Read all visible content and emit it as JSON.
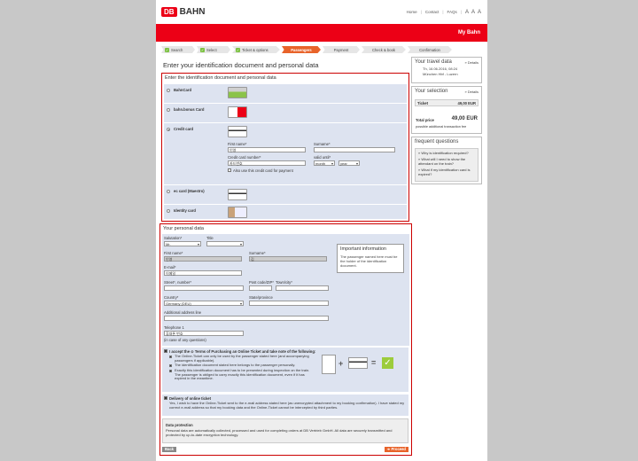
{
  "header": {
    "logo_db": "DB",
    "logo_bahn": "BAHN",
    "links": [
      "Home",
      "Contact",
      "FAQs"
    ],
    "text_size": "A A A",
    "section": "My Bahn"
  },
  "steps": [
    {
      "label": "Search",
      "done": true
    },
    {
      "label": "Select",
      "done": true
    },
    {
      "label": "Ticket & options",
      "done": true
    },
    {
      "label": "Passengers",
      "active": true
    },
    {
      "label": "Payment"
    },
    {
      "label": "Check & book"
    },
    {
      "label": "Confirmation"
    }
  ],
  "page_title": "Enter your identification document and personal data",
  "id_panel": {
    "title": "Enter the identification document and personal data",
    "options": [
      {
        "label": "BahnCard",
        "selected": false
      },
      {
        "label": "bahn.bonus Card",
        "selected": false
      },
      {
        "label": "Credit card",
        "selected": true
      },
      {
        "label": "ec card (Maestro)",
        "selected": false
      },
      {
        "label": "Identity card",
        "selected": false
      }
    ],
    "credit": {
      "first_name_label": "First name*",
      "first_name_value": "인영",
      "surname_label": "Surname*",
      "surname_value": "",
      "number_label": "Credit card number*",
      "number_value": "카드번호",
      "valid_label": "valid until*",
      "month": "month",
      "year": "year",
      "also_label": "Also use this credit card for payment"
    }
  },
  "personal": {
    "title": "Your personal data",
    "salutation_label": "Salutation*",
    "salutation_value": "Mr.",
    "title_label": "Title",
    "title_value": "",
    "first_label": "First name*",
    "first_value": "인영",
    "surname_label": "Surname*",
    "surname_value": "김",
    "email_label": "E-mail*",
    "email_value": "이메일",
    "street_label": "Street*, number*",
    "postcode_label": "Post code/ZIP*",
    "town_label": "Town/city*",
    "country_label": "Country*",
    "country_value": "Germany (DEU)",
    "state_label": "State/province",
    "addl_label": "Additional address line",
    "phone_label": "Telephone 1",
    "phone_value": "휴대폰 번호",
    "phone_hint": "(in case of any questions)",
    "info_title": "Important information",
    "info_body": "The passenger named here must be the holder of the identification document.",
    "terms_intro": "I accept the ⊙ Terms of Purchasing an Online Ticket and take note of the following:",
    "terms": [
      "The Online-Ticket can only be used by the passenger stated here (and accompanying passengers if applicable).",
      "The identification document stated here belongs to the passenger personally.",
      "Exactly this identification document has to be presented during inspection on the train. The passenger is obliged to carry exactly this identification document, even if it has expired in the meantime."
    ],
    "delivery_title": "Delivery of online ticket",
    "delivery_body": "Yes, I wish to have the Online-Ticket sent to the e-mail address stated here (as unencrypted attachment to my booking confirmation). I have stated my correct e-mail address so that my booking data and the Online-Ticket cannot be intercepted by third parties.",
    "protection_title": "Data protection",
    "protection_body": "Personal data are automatically collected, processed and used for completing orders at DB Vertrieb GmbH. All data are securely transmitted and protected by up-to-date encryption technology.",
    "back": "Back",
    "proceed": "Proceed"
  },
  "travel": {
    "title": "Your travel data",
    "details": "» Details",
    "date": "Th, 16.06.2016, 08:24",
    "route": "München Hbf - Luzern"
  },
  "selection": {
    "title": "Your selection",
    "details": "» Details",
    "ticket_label": "Ticket",
    "ticket_price": "49,00 EUR",
    "total_label": "Total price",
    "total_price": "49,00 EUR",
    "fee_note": "possible additional transaction fee"
  },
  "faq": {
    "title": "frequent questions",
    "items": [
      "Why is identification required?",
      "What will I need to show the attendant on the train?",
      "What if my identification card is expired?"
    ]
  },
  "colors": {
    "brand_red": "#ec0016",
    "accent_orange": "#e8632a",
    "panel_blue": "#dde3f0"
  }
}
